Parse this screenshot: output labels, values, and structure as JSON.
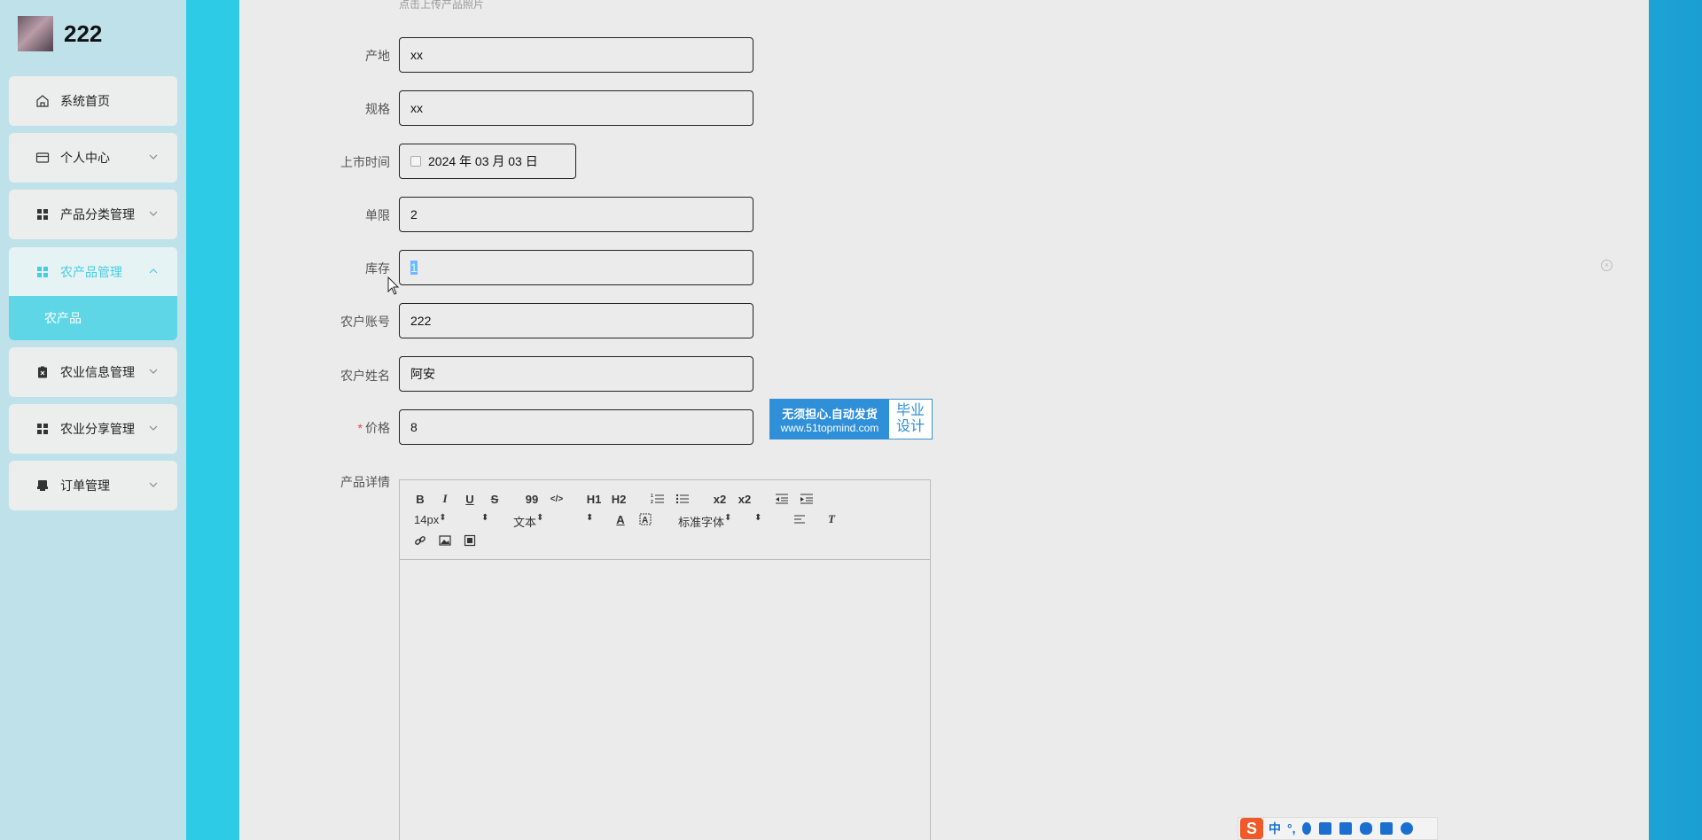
{
  "user": {
    "name": "222"
  },
  "sidebar": {
    "items": [
      {
        "label": "系统首页",
        "icon": "home-icon"
      },
      {
        "label": "个人中心",
        "icon": "card-icon"
      },
      {
        "label": "产品分类管理",
        "icon": "grid-icon"
      },
      {
        "label": "农产品管理",
        "icon": "grid-icon"
      },
      {
        "label": "农业信息管理",
        "icon": "clipboard-icon"
      },
      {
        "label": "农业分享管理",
        "icon": "grid-icon"
      },
      {
        "label": "订单管理",
        "icon": "printer-icon"
      }
    ],
    "submenu": {
      "label": "农产品"
    },
    "accent_color": "#45cde2"
  },
  "form": {
    "upload_hint": "点击上传产品照片",
    "fields": {
      "origin": {
        "label": "产地",
        "value": "xx"
      },
      "spec": {
        "label": "规格",
        "value": "xx"
      },
      "launch_date": {
        "label": "上市时间",
        "value": "2024 年 03 月 03 日"
      },
      "limit": {
        "label": "单限",
        "value": "2"
      },
      "stock": {
        "label": "库存",
        "value": "1"
      },
      "farmer_account": {
        "label": "农户账号",
        "value": "222"
      },
      "farmer_name": {
        "label": "农户姓名",
        "value": "阿安"
      },
      "price": {
        "label": "价格",
        "required_mark": "*",
        "value": "8"
      },
      "details": {
        "label": "产品详情"
      }
    }
  },
  "promo": {
    "line1": "无须担心.自动发货",
    "url": "www.51topmind.com",
    "right_line1": "毕业",
    "right_line2": "设计"
  },
  "editor": {
    "buttons": [
      "B",
      "I",
      "U",
      "S",
      "99",
      "</>",
      "H1",
      "H2",
      "ol",
      "ul",
      "x2",
      "x2",
      "outdent",
      "indent"
    ],
    "font_size": "14px",
    "text_type": "文本",
    "font_family": "标准字体"
  },
  "ime": {
    "lang": "中"
  }
}
